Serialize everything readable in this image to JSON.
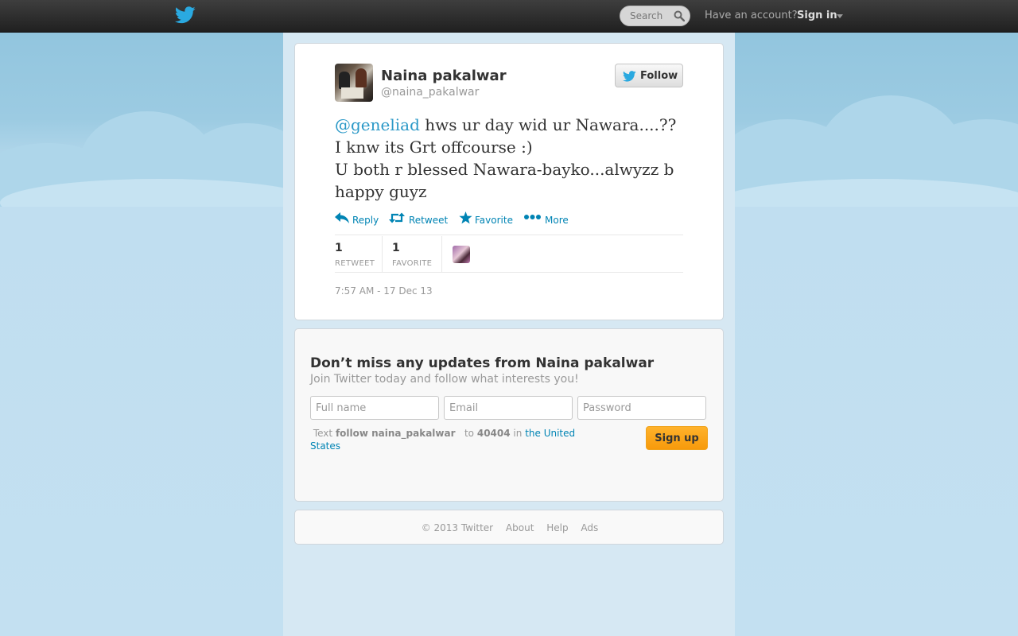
{
  "topbar": {
    "search_placeholder": "Search",
    "have_account": "Have an account?",
    "sign_in": "Sign in"
  },
  "tweet": {
    "display_name": "Naina pakalwar",
    "screen_name": "@naina_pakalwar",
    "follow_label": "Follow",
    "mention": "@geneliad",
    "line1": " hws ur day wid ur Nawara....??",
    "line2": "I knw its Grt offcourse :)",
    "line3": "U both r blessed Nawara-bayko...alwyzz b",
    "line4": "happy guyz",
    "actions": {
      "reply": "Reply",
      "retweet": "Retweet",
      "favorite": "Favorite",
      "more": "More"
    },
    "stats": {
      "retweets": "1",
      "retweets_label": "RETWEET",
      "favorites": "1",
      "favorites_label": "FAVORITE"
    },
    "timestamp": "7:57 AM - 17 Dec 13"
  },
  "signup": {
    "title": "Don’t miss any updates from Naina pakalwar",
    "subtitle": "Join Twitter today and follow what interests you!",
    "full_name_placeholder": "Full name",
    "email_placeholder": "Email",
    "password_placeholder": "Password",
    "sms_text": "Text",
    "sms_command": "follow naina_pakalwar",
    "sms_to": "to",
    "sms_number": "40404",
    "sms_in": "in",
    "sms_country": "the United States",
    "button": "Sign up"
  },
  "footer": {
    "copyright": "© 2013 Twitter",
    "about": "About",
    "help": "Help",
    "ads": "Ads"
  },
  "colors": {
    "link": "#0084b4",
    "mention": "#2a98c7",
    "signup_button": "#f79a0b",
    "topbar": "#2c2c2c"
  }
}
